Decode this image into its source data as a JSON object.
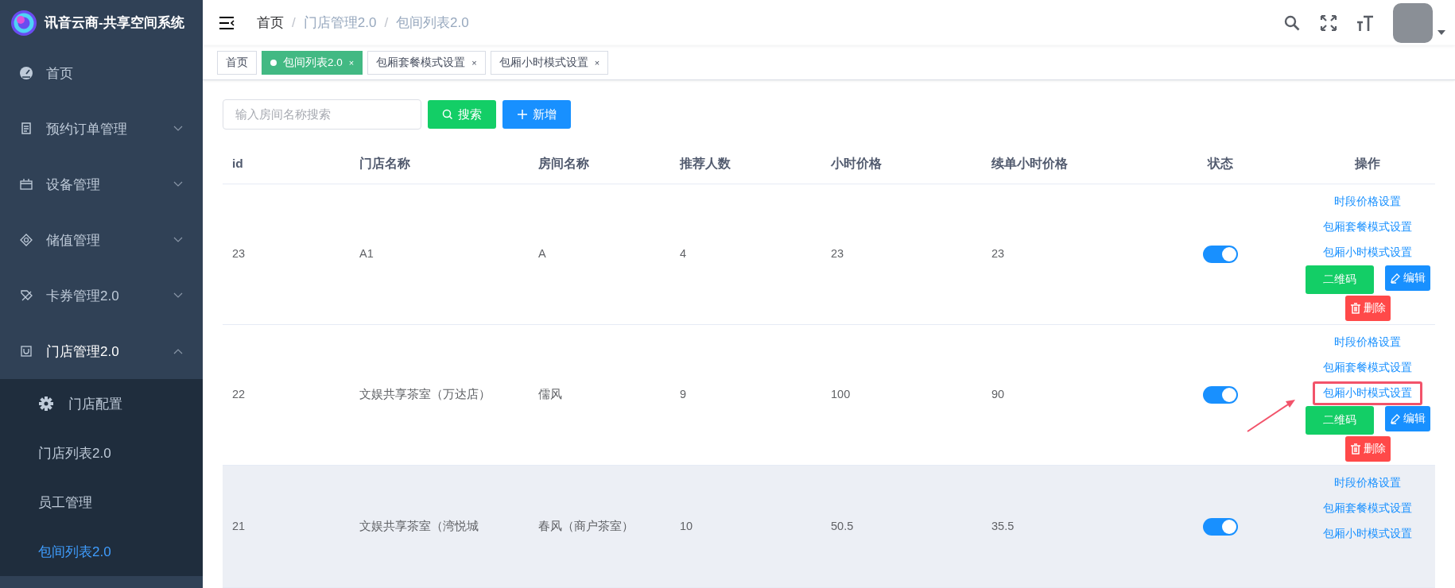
{
  "brand": {
    "title": "讯音云商-共享空间系统"
  },
  "breadcrumb_separator": "/",
  "breadcrumb": [
    {
      "label": "首页",
      "link": true
    },
    {
      "label": "门店管理2.0",
      "link": false
    },
    {
      "label": "包间列表2.0",
      "link": false
    }
  ],
  "sidebar": {
    "items": [
      {
        "label": "首页"
      },
      {
        "label": "预约订单管理",
        "expanded": false
      },
      {
        "label": "设备管理",
        "expanded": false
      },
      {
        "label": "储值管理",
        "expanded": false
      },
      {
        "label": "卡券管理2.0",
        "expanded": false
      },
      {
        "label": "门店管理2.0",
        "expanded": true,
        "children": [
          {
            "label": "门店配置",
            "kind": "settings",
            "selected": false
          },
          {
            "label": "门店列表2.0",
            "kind": "page",
            "selected": false
          },
          {
            "label": "员工管理",
            "kind": "page",
            "selected": false
          },
          {
            "label": "包间列表2.0",
            "kind": "page",
            "selected": true
          }
        ]
      }
    ]
  },
  "tabs": [
    {
      "label": "首页",
      "selected": false,
      "closable": false
    },
    {
      "label": "包间列表2.0",
      "selected": true,
      "closable": true
    },
    {
      "label": "包厢套餐模式设置",
      "selected": false,
      "closable": true
    },
    {
      "label": "包厢小时模式设置",
      "selected": false,
      "closable": true
    }
  ],
  "tab_close": "×",
  "search": {
    "placeholder": "输入房间名称搜索"
  },
  "toolbar": [
    {
      "label": "搜索",
      "kind": "search"
    },
    {
      "label": "新增",
      "kind": "add"
    }
  ],
  "table": {
    "columns": [
      "id",
      "门店名称",
      "房间名称",
      "推荐人数",
      "小时价格",
      "续单小时价格",
      "状态",
      "操作"
    ],
    "rows": [
      {
        "cells": [
          "23",
          "A1",
          "A",
          "4",
          "23",
          "23"
        ],
        "on": true,
        "hovered": false,
        "actions": [
          {
            "label": "时段价格设置",
            "highlighted": false
          },
          {
            "label": "包厢套餐模式设置",
            "highlighted": false
          },
          {
            "label": "包厢小时模式设置",
            "highlighted": false
          }
        ],
        "buttons": [
          {
            "label": "二维码",
            "kind": "qrcode"
          },
          {
            "label": "编辑",
            "kind": "edit"
          },
          {
            "label": "删除",
            "kind": "delete"
          }
        ]
      },
      {
        "cells": [
          "22",
          "文娱共享茶室（万达店）",
          "儒风",
          "9",
          "100",
          "90"
        ],
        "on": true,
        "hovered": false,
        "actions": [
          {
            "label": "时段价格设置",
            "highlighted": false
          },
          {
            "label": "包厢套餐模式设置",
            "highlighted": false
          },
          {
            "label": "包厢小时模式设置",
            "highlighted": true
          }
        ],
        "buttons": [
          {
            "label": "二维码",
            "kind": "qrcode"
          },
          {
            "label": "编辑",
            "kind": "edit"
          },
          {
            "label": "删除",
            "kind": "delete"
          }
        ]
      },
      {
        "cells": [
          "21",
          "文娱共享茶室（湾悦城",
          "春风（商户茶室）",
          "10",
          "50.5",
          "35.5"
        ],
        "on": true,
        "hovered": true,
        "actions": [
          {
            "label": "时段价格设置",
            "highlighted": false
          },
          {
            "label": "包厢套餐模式设置",
            "highlighted": false
          },
          {
            "label": "包厢小时模式设置",
            "highlighted": false
          }
        ]
      }
    ]
  }
}
